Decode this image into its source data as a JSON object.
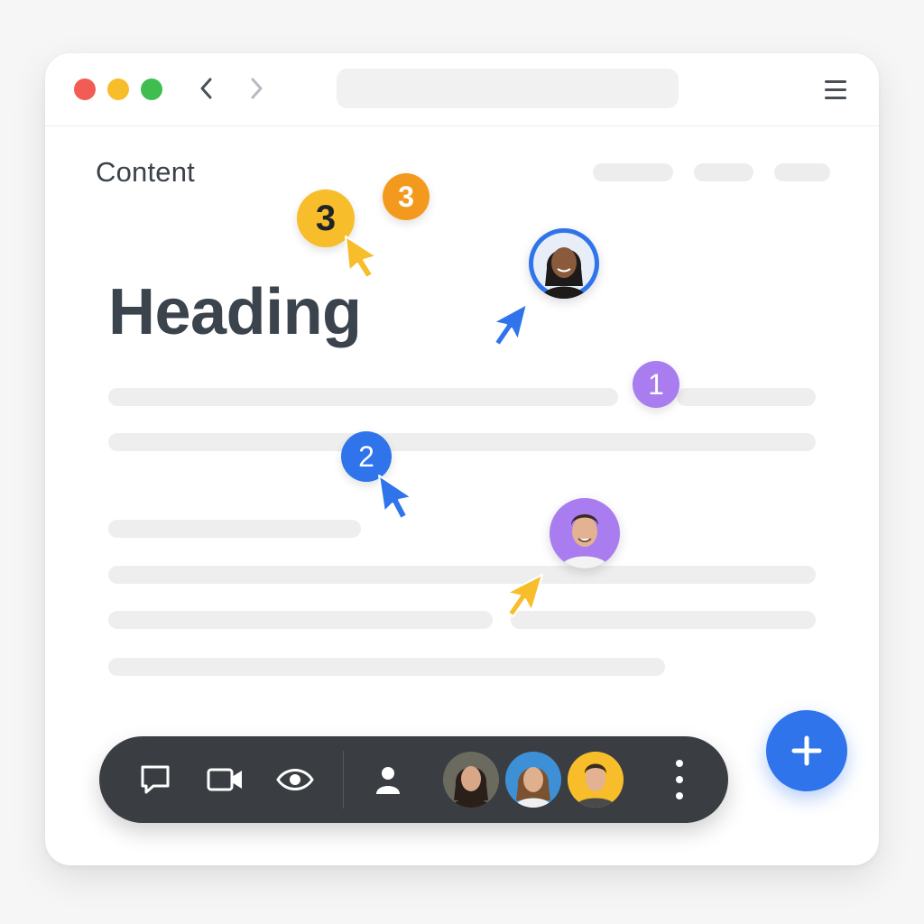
{
  "window": {
    "traffic_lights": [
      "close",
      "minimize",
      "maximize"
    ],
    "nav": {
      "back_icon": "chevron-left-icon",
      "forward_icon": "chevron-right-icon"
    },
    "menu_icon": "hamburger-menu-icon"
  },
  "page": {
    "content_label": "Content",
    "heading": "Heading"
  },
  "cursors": [
    {
      "badge": "3",
      "color": "#f7bd2a",
      "kind": "numbered"
    },
    {
      "badge": "3",
      "color": "#f39a1e",
      "kind": "numbered"
    },
    {
      "badge": "1",
      "color": "#a97cf0",
      "kind": "numbered"
    },
    {
      "badge": "2",
      "color": "#2f74ea",
      "kind": "numbered"
    },
    {
      "avatar": "woman-avatar",
      "color": "#2f74ea",
      "kind": "avatar"
    },
    {
      "avatar": "man-avatar",
      "color": "#a97cf0",
      "kind": "avatar"
    }
  ],
  "toolbar": {
    "actions": [
      "chat-bubble-icon",
      "video-camera-icon",
      "eye-icon",
      "person-icon"
    ],
    "participants": [
      "participant-1",
      "participant-2",
      "participant-3"
    ],
    "more_icon": "more-vertical-icon"
  },
  "fab": {
    "icon": "plus-icon",
    "color": "#2f74ea"
  },
  "colors": {
    "accent_blue": "#2f74ea",
    "accent_yellow": "#f7bd2a",
    "accent_orange": "#f39a1e",
    "accent_purple": "#a97cf0",
    "toolbar_bg": "#3a3d42"
  }
}
